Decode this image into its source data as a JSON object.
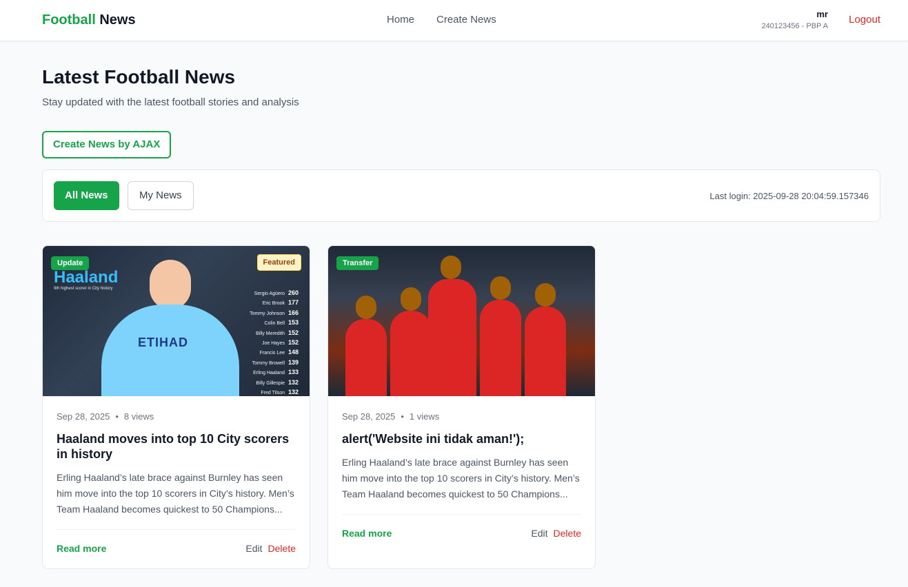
{
  "nav": {
    "brand_primary": "Football",
    "brand_secondary": "News",
    "links": [
      "Home",
      "Create News"
    ],
    "user_name": "mr",
    "user_meta": "240123456 - PBP A",
    "logout": "Logout"
  },
  "page": {
    "title": "Latest Football News",
    "subtitle": "Stay updated with the latest football stories and analysis",
    "ajax_button": "Create News by AJAX"
  },
  "filter": {
    "all": "All News",
    "mine": "My News",
    "last_login": "Last login: 2025-09-28 20:04:59.157346"
  },
  "cards": [
    {
      "category": "Update",
      "featured": "Featured",
      "date": "Sep 28, 2025",
      "views": "8 views",
      "title": "Haaland moves into top 10 City scorers in history",
      "excerpt": "Erling Haaland’s late brace against Burnley has seen him move into the top 10 scorers in City’s history. Men’s Team Haaland becomes quickest to 50 Champions...",
      "read_more": "Read more",
      "edit": "Edit",
      "delete": "Delete",
      "image_text": {
        "title": "Haaland",
        "subtitle": "9th highest scorer in City history",
        "shirt": "ETIHAD",
        "scorers": [
          {
            "name": "Sergio Agüero",
            "goals": "260"
          },
          {
            "name": "Eric Brook",
            "goals": "177"
          },
          {
            "name": "Tommy Johnson",
            "goals": "166"
          },
          {
            "name": "Colin Bell",
            "goals": "153"
          },
          {
            "name": "Billy Meredith",
            "goals": "152"
          },
          {
            "name": "Joe Hayes",
            "goals": "152"
          },
          {
            "name": "Francis Lee",
            "goals": "148"
          },
          {
            "name": "Tommy Browell",
            "goals": "139"
          },
          {
            "name": "Erling Haaland",
            "goals": "133"
          },
          {
            "name": "Billy Gillespie",
            "goals": "132"
          },
          {
            "name": "Fred Tilson",
            "goals": "132"
          }
        ]
      }
    },
    {
      "category": "Transfer",
      "date": "Sep 28, 2025",
      "views": "1 views",
      "title": "alert('Website ini tidak aman!');",
      "excerpt": "Erling Haaland’s late brace against Burnley has seen him move into the top 10 scorers in City’s history. Men’s Team Haaland becomes quickest to 50 Champions...",
      "read_more": "Read more",
      "edit": "Edit",
      "delete": "Delete"
    }
  ]
}
